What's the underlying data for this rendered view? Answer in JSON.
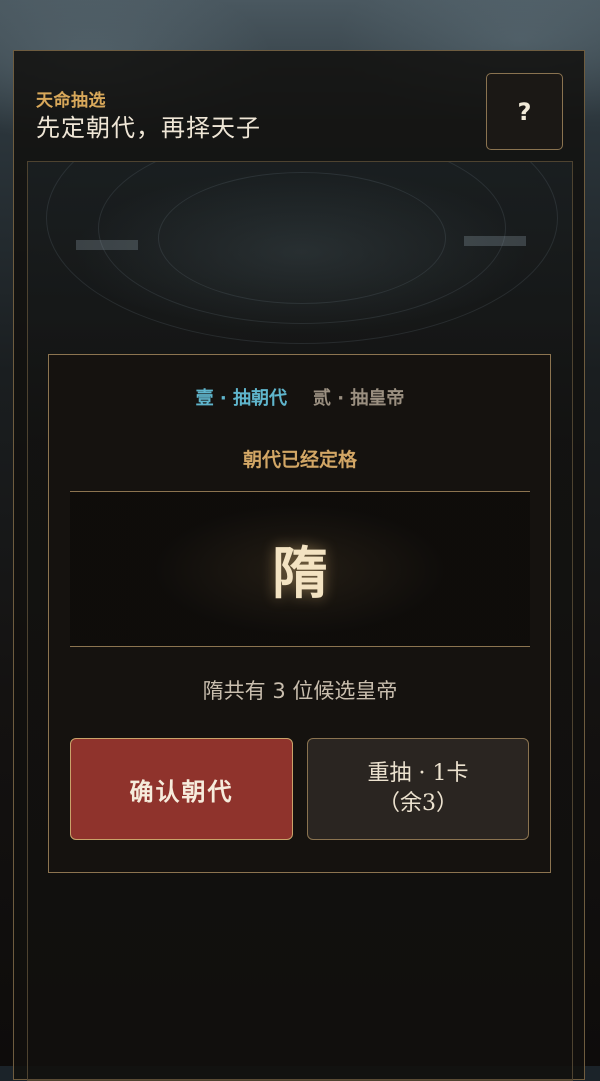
{
  "header": {
    "subtitle": "天命抽选",
    "title": "先定朝代，再择天子",
    "help_label": "?"
  },
  "steps": {
    "step1": "壹 · 抽朝代",
    "step2": "贰 · 抽皇帝"
  },
  "status_text": "朝代已经定格",
  "dynasty": "隋",
  "candidate_text": "隋共有 3 位候选皇帝",
  "actions": {
    "confirm_label": "确认朝代",
    "redraw_line1": "重抽 · 1卡",
    "redraw_line2": "（余3）"
  },
  "colors": {
    "accent_gold": "#d2a665",
    "active_step": "#5fb5cc",
    "confirm_bg": "#8f332c"
  }
}
